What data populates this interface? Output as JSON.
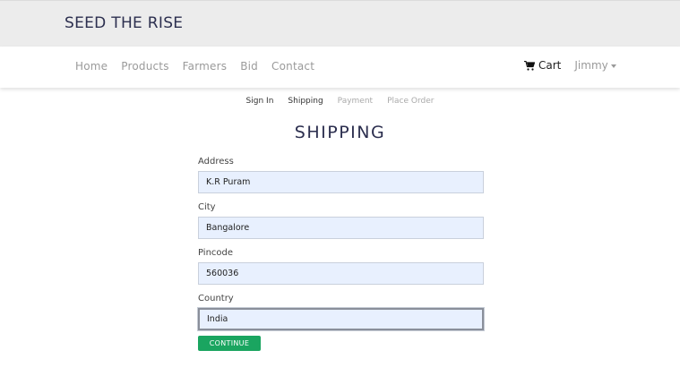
{
  "brand": {
    "title": "SEED THE RISE"
  },
  "nav": {
    "links": [
      "Home",
      "Products",
      "Farmers",
      "Bid",
      "Contact"
    ],
    "cart_label": "Cart",
    "user_label": "Jimmy"
  },
  "steps": [
    {
      "label": "Sign In",
      "state": "active"
    },
    {
      "label": "Shipping",
      "state": "active"
    },
    {
      "label": "Payment",
      "state": "disabled"
    },
    {
      "label": "Place Order",
      "state": "disabled"
    }
  ],
  "page": {
    "title": "SHIPPING"
  },
  "form": {
    "address": {
      "label": "Address",
      "value": "K.R Puram"
    },
    "city": {
      "label": "City",
      "value": "Bangalore"
    },
    "pincode": {
      "label": "Pincode",
      "value": "560036"
    },
    "country": {
      "label": "Country",
      "value": "India"
    },
    "submit_label": "CONTINUE"
  },
  "colors": {
    "brand_text": "#2c2f4f",
    "button_green": "#1aa560",
    "input_fill": "#e8f0fe"
  }
}
